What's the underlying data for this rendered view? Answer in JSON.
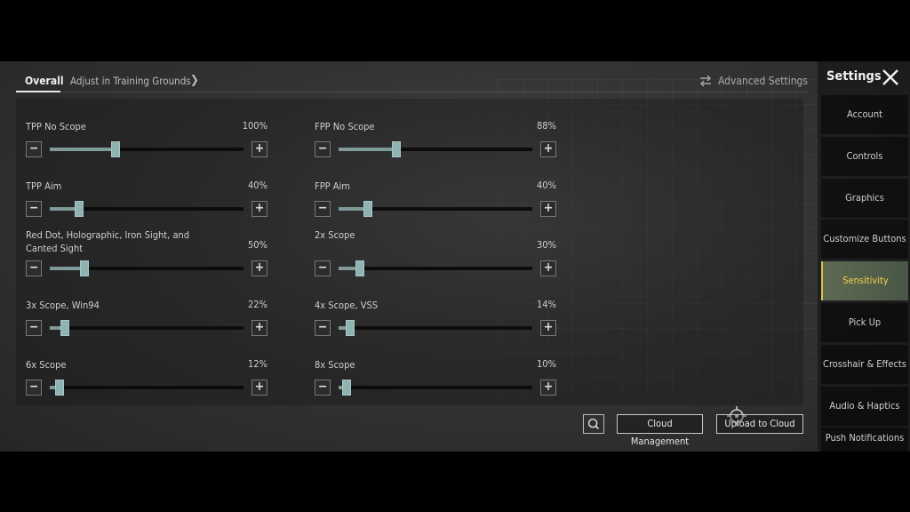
{
  "topbar": {
    "tab_overall": "Overall",
    "tab_training": "Adjust in Training Grounds",
    "advanced_label": "Advanced Settings"
  },
  "sliders": [
    {
      "label": "TPP No Scope",
      "value_text": "100%",
      "fraction": 0.34
    },
    {
      "label": "FPP No Scope",
      "value_text": "88%",
      "fraction": 0.3
    },
    {
      "label": "TPP Aim",
      "value_text": "40%",
      "fraction": 0.15
    },
    {
      "label": "FPP Aim",
      "value_text": "40%",
      "fraction": 0.15
    },
    {
      "label": "Red Dot, Holographic, Iron Sight, and Canted Sight",
      "value_text": "50%",
      "fraction": 0.18
    },
    {
      "label": "2x Scope",
      "value_text": "30%",
      "fraction": 0.11
    },
    {
      "label": "3x Scope, Win94",
      "value_text": "22%",
      "fraction": 0.08
    },
    {
      "label": "4x Scope, VSS",
      "value_text": "14%",
      "fraction": 0.06
    },
    {
      "label": "6x Scope",
      "value_text": "12%",
      "fraction": 0.05
    },
    {
      "label": "8x Scope",
      "value_text": "10%",
      "fraction": 0.04
    }
  ],
  "buttons": {
    "cloud_management": "Cloud Management",
    "upload_to_cloud": "Upload to Cloud"
  },
  "sidebar": {
    "title": "Settings",
    "items": [
      {
        "label": "Account"
      },
      {
        "label": "Controls"
      },
      {
        "label": "Graphics"
      },
      {
        "label": "Customize Buttons"
      },
      {
        "label": "Sensitivity",
        "active": true
      },
      {
        "label": "Pick Up"
      },
      {
        "label": "Crosshair & Effects"
      },
      {
        "label": "Audio & Haptics"
      },
      {
        "label": "Push Notifications"
      }
    ]
  },
  "colors": {
    "accent_active_text": "#f5d34a",
    "slider_knob": "#8fb3b1",
    "active_tab_bg": "#5d6a52"
  }
}
